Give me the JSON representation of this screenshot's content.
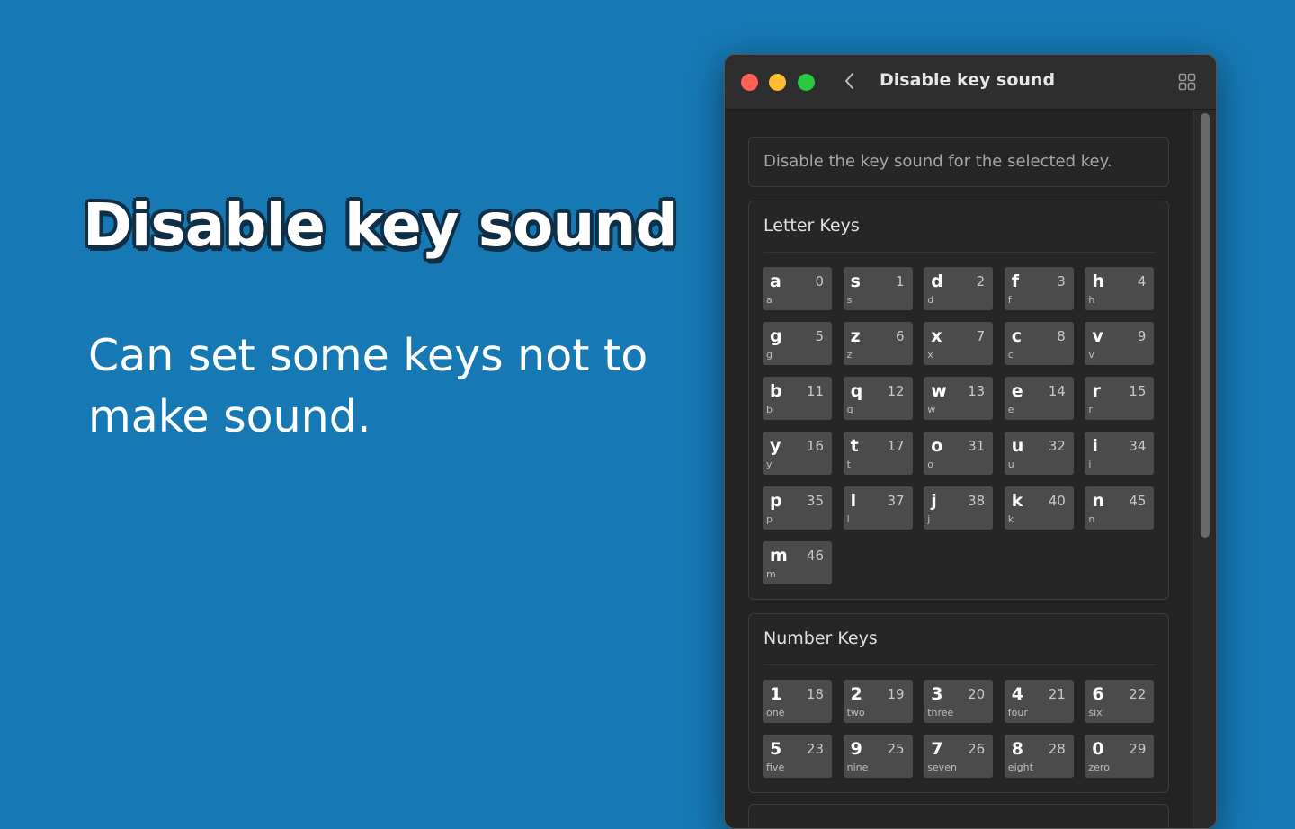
{
  "promo": {
    "title": "Disable key sound",
    "subtitle": "Can set some keys not to make sound."
  },
  "window": {
    "title": "Disable key sound",
    "description": "Disable the key sound for the selected key."
  },
  "groups": [
    {
      "title": "Letter Keys",
      "keys": [
        {
          "key": "a",
          "code": "0",
          "sub": "a"
        },
        {
          "key": "s",
          "code": "1",
          "sub": "s"
        },
        {
          "key": "d",
          "code": "2",
          "sub": "d"
        },
        {
          "key": "f",
          "code": "3",
          "sub": "f"
        },
        {
          "key": "h",
          "code": "4",
          "sub": "h"
        },
        {
          "key": "g",
          "code": "5",
          "sub": "g"
        },
        {
          "key": "z",
          "code": "6",
          "sub": "z"
        },
        {
          "key": "x",
          "code": "7",
          "sub": "x"
        },
        {
          "key": "c",
          "code": "8",
          "sub": "c"
        },
        {
          "key": "v",
          "code": "9",
          "sub": "v"
        },
        {
          "key": "b",
          "code": "11",
          "sub": "b"
        },
        {
          "key": "q",
          "code": "12",
          "sub": "q"
        },
        {
          "key": "w",
          "code": "13",
          "sub": "w"
        },
        {
          "key": "e",
          "code": "14",
          "sub": "e"
        },
        {
          "key": "r",
          "code": "15",
          "sub": "r"
        },
        {
          "key": "y",
          "code": "16",
          "sub": "y"
        },
        {
          "key": "t",
          "code": "17",
          "sub": "t"
        },
        {
          "key": "o",
          "code": "31",
          "sub": "o"
        },
        {
          "key": "u",
          "code": "32",
          "sub": "u"
        },
        {
          "key": "i",
          "code": "34",
          "sub": "i"
        },
        {
          "key": "p",
          "code": "35",
          "sub": "p"
        },
        {
          "key": "l",
          "code": "37",
          "sub": "l"
        },
        {
          "key": "j",
          "code": "38",
          "sub": "j"
        },
        {
          "key": "k",
          "code": "40",
          "sub": "k"
        },
        {
          "key": "n",
          "code": "45",
          "sub": "n"
        },
        {
          "key": "m",
          "code": "46",
          "sub": "m"
        }
      ]
    },
    {
      "title": "Number Keys",
      "keys": [
        {
          "key": "1",
          "code": "18",
          "sub": "one"
        },
        {
          "key": "2",
          "code": "19",
          "sub": "two"
        },
        {
          "key": "3",
          "code": "20",
          "sub": "three"
        },
        {
          "key": "4",
          "code": "21",
          "sub": "four"
        },
        {
          "key": "6",
          "code": "22",
          "sub": "six"
        },
        {
          "key": "5",
          "code": "23",
          "sub": "five"
        },
        {
          "key": "9",
          "code": "25",
          "sub": "nine"
        },
        {
          "key": "7",
          "code": "26",
          "sub": "seven"
        },
        {
          "key": "8",
          "code": "28",
          "sub": "eight"
        },
        {
          "key": "0",
          "code": "29",
          "sub": "zero"
        }
      ]
    }
  ],
  "icons": {
    "back": "chevron-left-icon",
    "view": "grid-view-icon"
  },
  "colors": {
    "background": "#1679b3",
    "window": "#232323",
    "key": "#4b4b4b"
  }
}
